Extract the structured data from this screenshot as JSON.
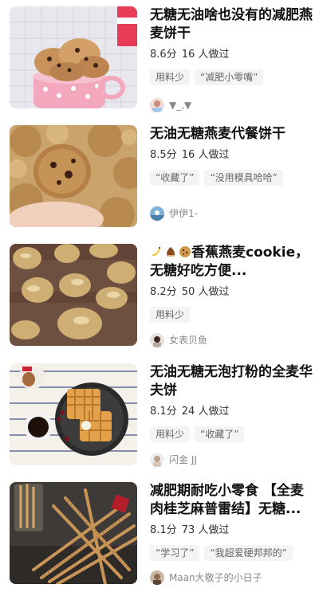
{
  "recipes": [
    {
      "title": "无糖无油啥也没有的减肥燕麦饼干",
      "rating": "8.6分",
      "made": "16 人做过",
      "tags": [
        "用料少",
        "“减肥小零嘴”"
      ],
      "author": "▼_,▼"
    },
    {
      "title": "无油无糖燕麦代餐饼干",
      "rating": "8.5分",
      "made": "16 人做过",
      "tags": [
        "“收藏了”",
        "“没用模具哈哈”"
      ],
      "author": "伊伊1-"
    },
    {
      "title_text": "香蕉燕麦cookie，无糖好吃方便...",
      "title_emoji": [
        "banana-icon",
        "chestnut-icon",
        "cookie-icon"
      ],
      "rating": "8.2分",
      "made": "50 人做过",
      "tags": [
        "用料少"
      ],
      "author": "女表贝鱼"
    },
    {
      "title": "无油无糖无泡打粉的全麦华夫饼",
      "rating": "8.1分",
      "made": "24 人做过",
      "tags": [
        "用料少",
        "“收藏了”"
      ],
      "author": "闪金 JJ"
    },
    {
      "title": "减肥期耐吃小零食 【全麦肉桂芝麻普雷结】无糖...",
      "rating": "8.1分",
      "made": "73 人做过",
      "tags": [
        "“学习了”",
        "“我超爱硬邦邦的”"
      ],
      "author": "Maan大敬子的小日子"
    }
  ]
}
